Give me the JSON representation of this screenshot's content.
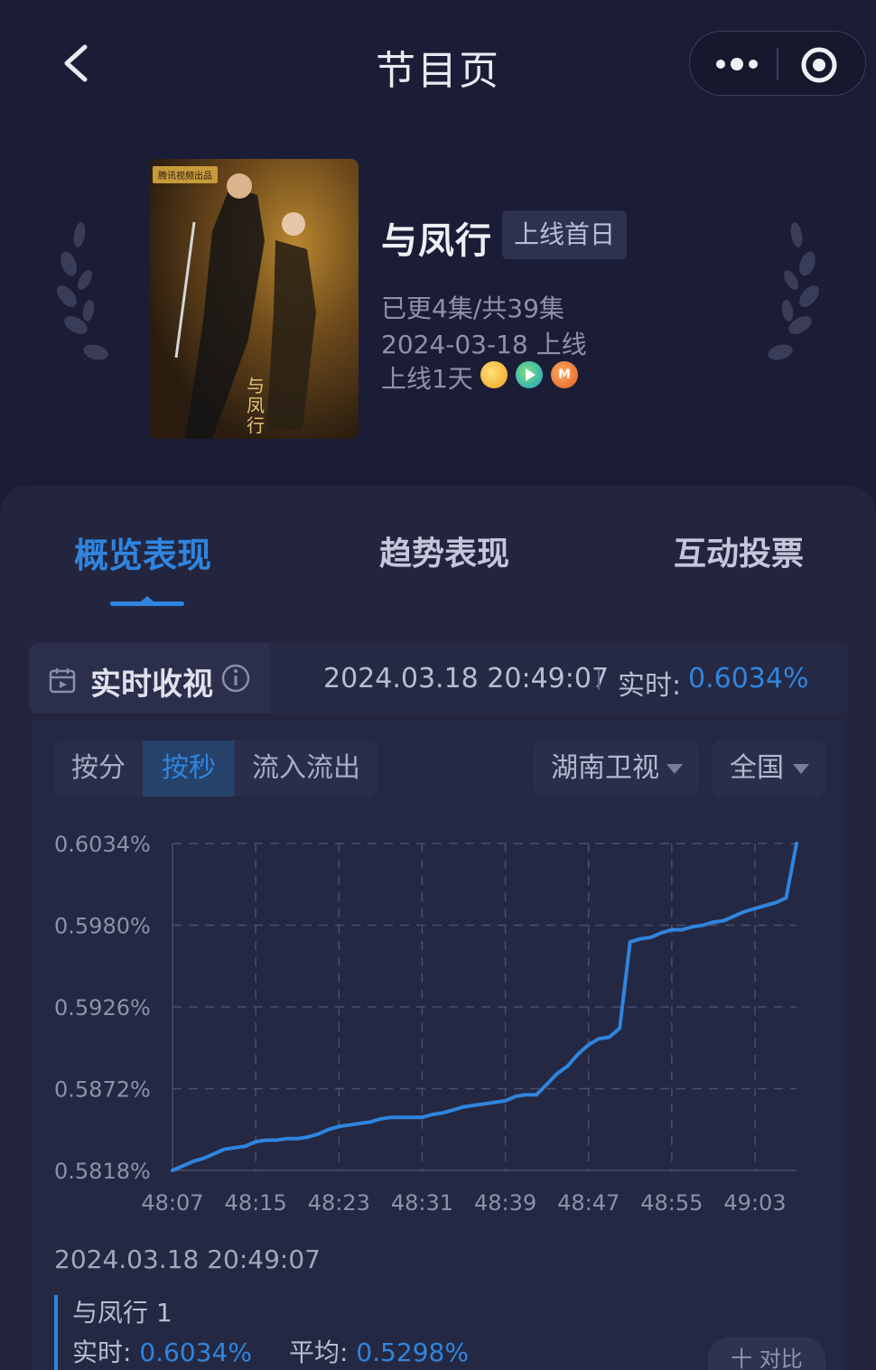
{
  "navbar": {
    "title": "节目页"
  },
  "show": {
    "name": "与凤行",
    "badge": "上线首日",
    "episodes": "已更4集/共39集",
    "release": "2024-03-18 上线",
    "days_online": "上线1天",
    "poster_badge": "腾讯视频出品",
    "poster_title": "与凤行",
    "platforms": [
      "mango-tv-icon",
      "tencent-video-icon",
      "mgtv-icon"
    ]
  },
  "tabs": {
    "overview": "概览表现",
    "trend": "趋势表现",
    "vote": "互动投票",
    "active": "概览表现"
  },
  "realtime": {
    "label": "实时收视",
    "timestamp": "2024.03.18 20:49:07",
    "value_label": "实时:",
    "value": "0.6034%"
  },
  "segments": {
    "by_minute": "按分",
    "by_second": "按秒",
    "flow": "流入流出",
    "active": "按秒"
  },
  "filters": {
    "channel": "湖南卫视",
    "region": "全国"
  },
  "chart_data": {
    "type": "line",
    "x_ticks": [
      "48:07",
      "48:15",
      "48:23",
      "48:31",
      "48:39",
      "48:47",
      "48:55",
      "49:03"
    ],
    "y_ticks": [
      "0.6034%",
      "0.5980%",
      "0.5926%",
      "0.5872%",
      "0.5818%"
    ],
    "ylim": [
      0.5818,
      0.6034
    ],
    "xlim_seconds": [
      0,
      60
    ],
    "grid": true,
    "color": "#2f85de",
    "series": [
      {
        "x": [
          0,
          1,
          2,
          3,
          4,
          5,
          6,
          7,
          8,
          9,
          10,
          11,
          12,
          13,
          14,
          15,
          16,
          17,
          18,
          19,
          20,
          21,
          22,
          23,
          24,
          25,
          26,
          27,
          28,
          29,
          30,
          31,
          32,
          33,
          34,
          35,
          36,
          37,
          38,
          39,
          40,
          41,
          42,
          43,
          44,
          45,
          46,
          47,
          48,
          49,
          50,
          51,
          52,
          53,
          54,
          55,
          56,
          57,
          58,
          59,
          60
        ],
        "values": [
          0.5818,
          0.5821,
          0.5824,
          0.5826,
          0.5829,
          0.5832,
          0.5833,
          0.5834,
          0.5837,
          0.5838,
          0.5838,
          0.5839,
          0.5839,
          0.584,
          0.5842,
          0.5845,
          0.5847,
          0.5848,
          0.5849,
          0.585,
          0.5852,
          0.5853,
          0.5853,
          0.5853,
          0.5853,
          0.5855,
          0.5856,
          0.5858,
          0.586,
          0.5861,
          0.5862,
          0.5863,
          0.5864,
          0.5867,
          0.5868,
          0.5868,
          0.5875,
          0.5882,
          0.5887,
          0.5895,
          0.5901,
          0.5905,
          0.5906,
          0.5912,
          0.5969,
          0.5971,
          0.5972,
          0.5975,
          0.5977,
          0.5977,
          0.5979,
          0.598,
          0.5982,
          0.5983,
          0.5986,
          0.5989,
          0.5991,
          0.5993,
          0.5995,
          0.5998,
          0.6034
        ]
      }
    ]
  },
  "detail": {
    "timestamp": "2024.03.18 20:49:07",
    "series_name": "与凤行 1",
    "realtime_label": "实时:",
    "realtime_value": "0.6034%",
    "avg_label": "平均:",
    "avg_value": "0.5298%",
    "float_button": "十 对比"
  }
}
